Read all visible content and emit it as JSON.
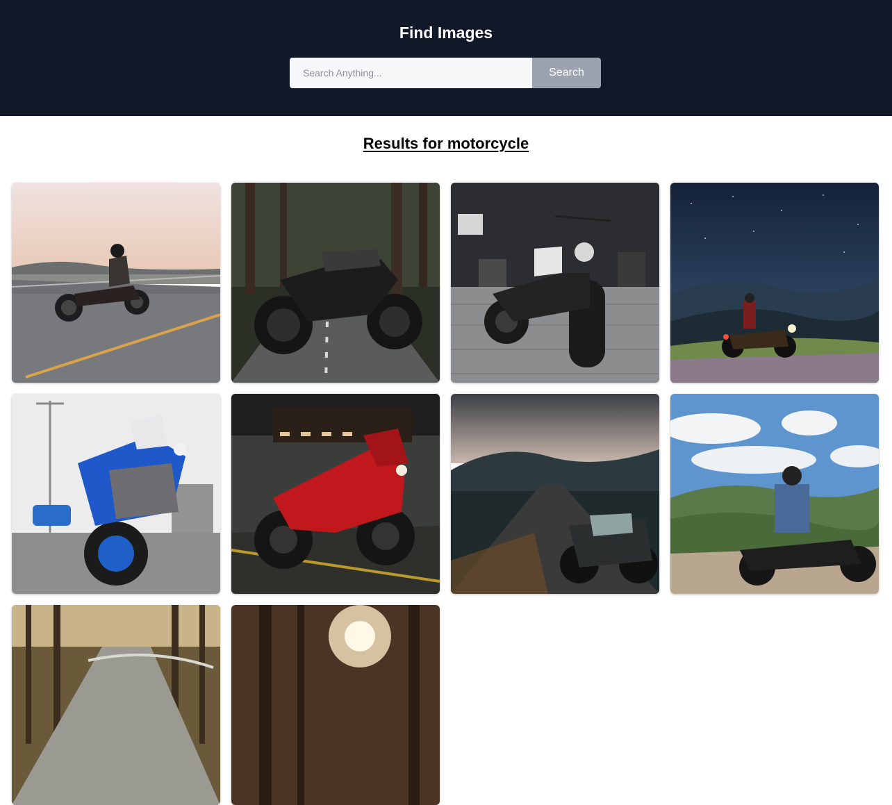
{
  "header": {
    "title": "Find Images"
  },
  "search": {
    "placeholder": "Search Anything...",
    "value": "",
    "button_label": "Search"
  },
  "results": {
    "heading": "Results for motorcycle",
    "query": "motorcycle",
    "images": [
      {
        "subject": "rider on highway at sunset"
      },
      {
        "subject": "black naked motorcycle on forest road"
      },
      {
        "subject": "cruiser parked on cobblestone street"
      },
      {
        "subject": "rider with motorcycle on hill at night"
      },
      {
        "subject": "blue sport bike on street"
      },
      {
        "subject": "red sport bike in parking garage"
      },
      {
        "subject": "motorcycle on mountain road at dusk"
      },
      {
        "subject": "rider seated on cruiser overlooking valley"
      },
      {
        "subject": "blurred road through autumn forest"
      },
      {
        "subject": "sunlight through trees"
      }
    ]
  },
  "colors": {
    "header_bg": "#111827",
    "button_bg": "#9ca3af",
    "input_bg": "#f5f7f9"
  }
}
